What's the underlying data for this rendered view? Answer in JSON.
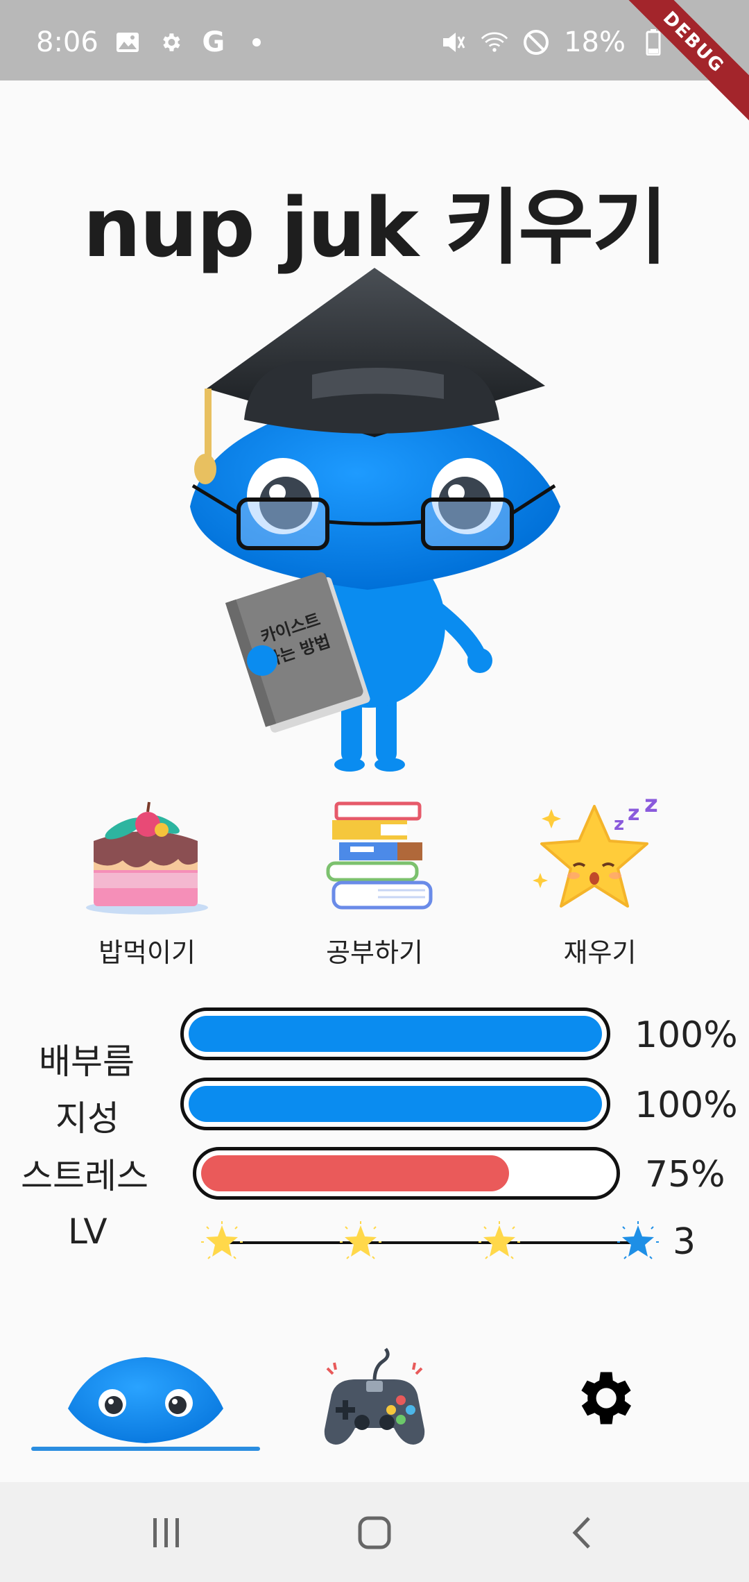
{
  "status_bar": {
    "time": "8:06",
    "battery": "18%",
    "left_icons": [
      "image-icon",
      "gear-icon",
      "google-icon",
      "dot-icon"
    ],
    "right_icons": [
      "mute-icon",
      "wifi-icon",
      "block-icon",
      "battery-icon"
    ]
  },
  "debug_banner": "DEBUG",
  "title": "nup juk 키우기",
  "mascot": {
    "book_line1": "카이스트",
    "book_line2": "가는 방법"
  },
  "actions": [
    {
      "label": "밥먹이기",
      "icon": "cake-icon"
    },
    {
      "label": "공부하기",
      "icon": "books-icon"
    },
    {
      "label": "재우기",
      "icon": "sleeping-star-icon"
    }
  ],
  "stats": [
    {
      "label": "배부름",
      "value_text": "100%",
      "value": 1.0,
      "color": "#0a8cf0"
    },
    {
      "label": "지성",
      "value_text": "100%",
      "value": 1.0,
      "color": "#0a8cf0"
    },
    {
      "label": "스트레스",
      "value_text": "75%",
      "value": 0.75,
      "color": "#ea5a5a"
    }
  ],
  "level": {
    "label": "LV",
    "value": "3",
    "stars_total": 4,
    "current_index": 3,
    "star_color": "#ffd84a",
    "current_star_color": "#1e8fe6"
  },
  "bottom_nav": [
    {
      "name": "home",
      "icon": "blob-face-icon",
      "selected": true
    },
    {
      "name": "game",
      "icon": "gamepad-icon",
      "selected": false
    },
    {
      "name": "settings",
      "icon": "gear-icon",
      "selected": false
    }
  ],
  "colors": {
    "accent": "#2a8de0",
    "mascot_blue": "#0a8cf0",
    "stress_red": "#ea5a5a"
  }
}
